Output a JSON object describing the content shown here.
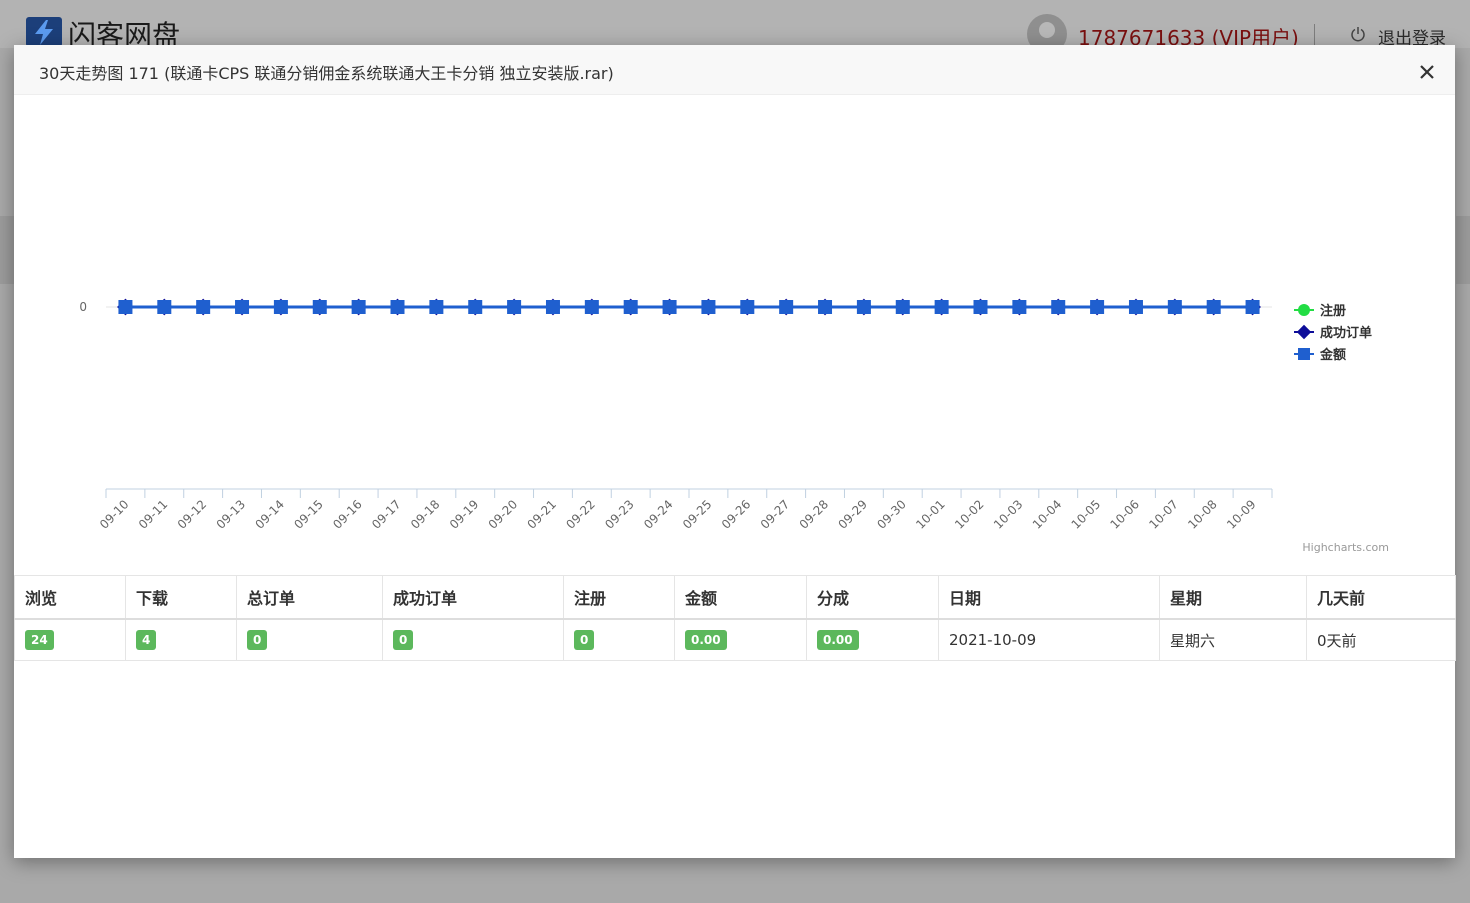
{
  "background": {
    "brand": "闪客网盘",
    "user": "1787671633 (VIP用户)",
    "logout_label": "退出登录"
  },
  "modal": {
    "title": "30天走势图 171 (联通卡CPS 联通分销佣金系统联通大王卡分销 独立安装版.rar)",
    "close_icon": "close-icon"
  },
  "chart_data": {
    "type": "line",
    "categories": [
      "09-10",
      "09-11",
      "09-12",
      "09-13",
      "09-14",
      "09-15",
      "09-16",
      "09-17",
      "09-18",
      "09-19",
      "09-20",
      "09-21",
      "09-22",
      "09-23",
      "09-24",
      "09-25",
      "09-26",
      "09-27",
      "09-28",
      "09-29",
      "09-30",
      "10-01",
      "10-02",
      "10-03",
      "10-04",
      "10-05",
      "10-06",
      "10-07",
      "10-08",
      "10-09"
    ],
    "series": [
      {
        "name": "注册",
        "color": "#22dd44",
        "marker": "circle",
        "values": [
          0,
          0,
          0,
          0,
          0,
          0,
          0,
          0,
          0,
          0,
          0,
          0,
          0,
          0,
          0,
          0,
          0,
          0,
          0,
          0,
          0,
          0,
          0,
          0,
          0,
          0,
          0,
          0,
          0,
          0
        ]
      },
      {
        "name": "成功订单",
        "color": "#0d0d99",
        "marker": "diamond",
        "values": [
          0,
          0,
          0,
          0,
          0,
          0,
          0,
          0,
          0,
          0,
          0,
          0,
          0,
          0,
          0,
          0,
          0,
          0,
          0,
          0,
          0,
          0,
          0,
          0,
          0,
          0,
          0,
          0,
          0,
          0
        ]
      },
      {
        "name": "金额",
        "color": "#1f5fcf",
        "marker": "square",
        "values": [
          0,
          0,
          0,
          0,
          0,
          0,
          0,
          0,
          0,
          0,
          0,
          0,
          0,
          0,
          0,
          0,
          0,
          0,
          0,
          0,
          0,
          0,
          0,
          0,
          0,
          0,
          0,
          0,
          0,
          0
        ]
      }
    ],
    "y_ticks": [
      "0"
    ],
    "legend_position": "right",
    "credits": "Highcharts.com"
  },
  "table": {
    "headers": [
      "浏览",
      "下载",
      "总订单",
      "成功订单",
      "注册",
      "金额",
      "分成",
      "日期",
      "星期",
      "几天前"
    ],
    "row": {
      "views": "24",
      "downloads": "4",
      "total_orders": "0",
      "success_orders": "0",
      "registrations": "0",
      "amount": "0.00",
      "commission": "0.00",
      "date": "2021-10-09",
      "weekday": "星期六",
      "days_ago": "0天前"
    }
  }
}
